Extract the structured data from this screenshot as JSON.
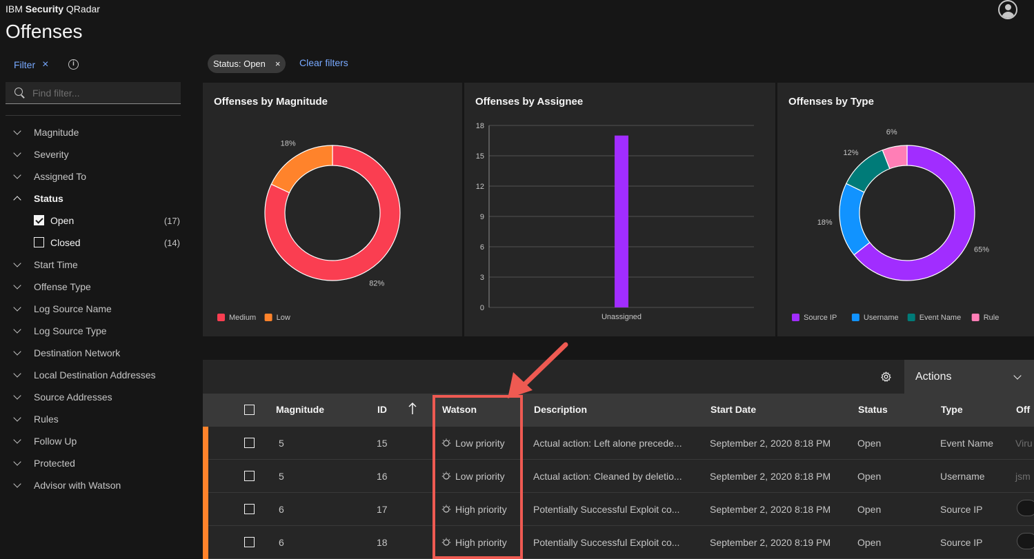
{
  "header": {
    "brand_prefix": "IBM",
    "brand_bold": "Security",
    "brand_suffix": "QRadar",
    "page_title": "Offenses"
  },
  "sidebar": {
    "filter_label": "Filter",
    "search_placeholder": "Find filter...",
    "categories": [
      {
        "label": "Magnitude"
      },
      {
        "label": "Severity"
      },
      {
        "label": "Assigned To"
      },
      {
        "label": "Status"
      },
      {
        "label": "Start Time"
      },
      {
        "label": "Offense Type"
      },
      {
        "label": "Log Source Name"
      },
      {
        "label": "Log Source Type"
      },
      {
        "label": "Destination Network"
      },
      {
        "label": "Local Destination Addresses"
      },
      {
        "label": "Source Addresses"
      },
      {
        "label": "Rules"
      },
      {
        "label": "Follow Up"
      },
      {
        "label": "Protected"
      },
      {
        "label": "Advisor with Watson"
      }
    ],
    "status_options": [
      {
        "label": "Open",
        "count": "(17)",
        "checked": true
      },
      {
        "label": "Closed",
        "count": "(14)",
        "checked": false
      }
    ]
  },
  "filters": {
    "active_tag": "Status: Open",
    "clear_label": "Clear filters"
  },
  "chart_data": [
    {
      "type": "pie",
      "title": "Offenses by Magnitude",
      "donut": true,
      "slices": [
        {
          "label": "Medium",
          "value": 82,
          "display": "82%",
          "color": "#fa3e51"
        },
        {
          "label": "Low",
          "value": 18,
          "display": "18%",
          "color": "#ff832b"
        }
      ],
      "legend": "bottom-left"
    },
    {
      "type": "bar",
      "title": "Offenses by Assignee",
      "categories": [
        "Unassigned"
      ],
      "values": [
        17
      ],
      "yticks": [
        "0",
        "3",
        "6",
        "9",
        "12",
        "15",
        "18"
      ],
      "ylim": [
        0,
        18
      ],
      "color": "#a12dff",
      "grid": true
    },
    {
      "type": "pie",
      "title": "Offenses by Type",
      "donut": true,
      "slices": [
        {
          "label": "Source IP",
          "value": 65,
          "display": "65%",
          "color": "#a12dff"
        },
        {
          "label": "Username",
          "value": 18,
          "display": "18%",
          "color": "#1193ff"
        },
        {
          "label": "Event Name",
          "value": 12,
          "display": "12%",
          "color": "#007b78"
        },
        {
          "label": "Rule",
          "value": 6,
          "display": "6%",
          "color": "#ff7eb6"
        }
      ],
      "legend": "bottom-left"
    }
  ],
  "toolbar": {
    "actions_label": "Actions",
    "settings_icon": "gear-icon"
  },
  "table": {
    "columns": {
      "magnitude": "Magnitude",
      "id": "ID",
      "watson": "Watson",
      "description": "Description",
      "start_date": "Start Date",
      "status": "Status",
      "type": "Type",
      "overflow": "Off"
    },
    "rows": [
      {
        "magnitude": "5",
        "id": "15",
        "watson": "Low priority",
        "description": "Actual action: Left alone precede...",
        "start_date": "September 2, 2020 8:18 PM",
        "status": "Open",
        "type": "Event Name",
        "overflow": "Viru"
      },
      {
        "magnitude": "5",
        "id": "16",
        "watson": "Low priority",
        "description": "Actual action: Cleaned by deletio...",
        "start_date": "September 2, 2020 8:18 PM",
        "status": "Open",
        "type": "Username",
        "overflow": "jsm"
      },
      {
        "magnitude": "6",
        "id": "17",
        "watson": "High priority",
        "description": "Potentially Successful Exploit co...",
        "start_date": "September 2, 2020 8:18 PM",
        "status": "Open",
        "type": "Source IP",
        "overflow": ""
      },
      {
        "magnitude": "6",
        "id": "18",
        "watson": "High priority",
        "description": "Potentially Successful Exploit co...",
        "start_date": "September 2, 2020 8:19 PM",
        "status": "Open",
        "type": "Source IP",
        "overflow": ""
      }
    ],
    "row_accent_color": "#ff832b"
  },
  "annotation": {
    "highlight_color": "#ee5a52"
  }
}
